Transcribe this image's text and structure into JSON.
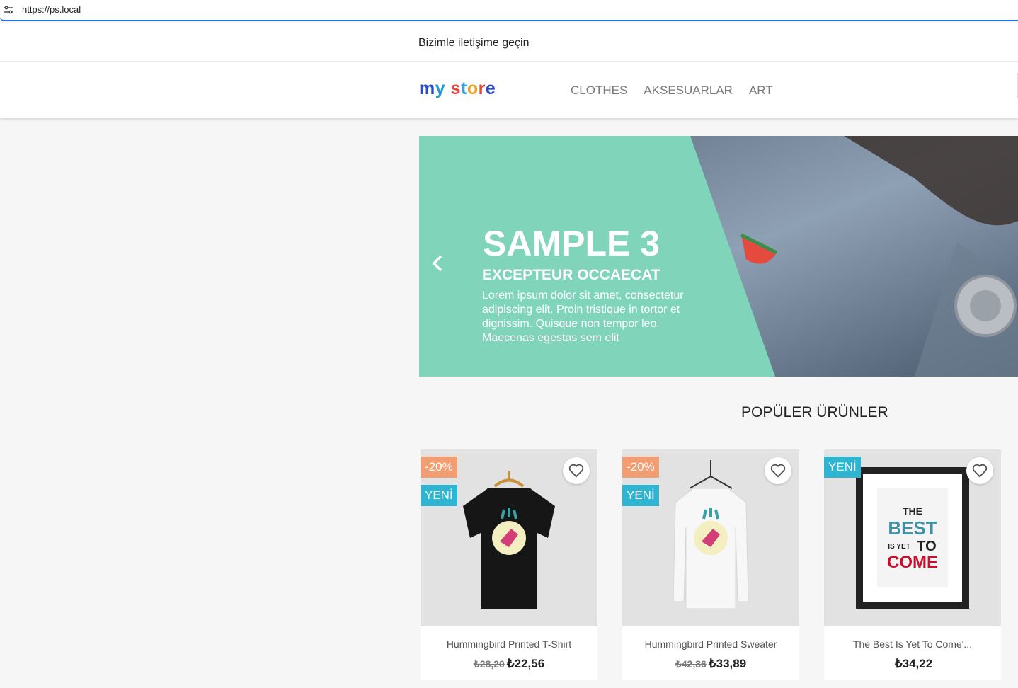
{
  "browser": {
    "url": "https://ps.local",
    "icon": "tune-icon"
  },
  "contact": {
    "text": "Bizimle iletişime geçin"
  },
  "logo": {
    "parts": [
      "m",
      "y",
      " ",
      "s",
      "t",
      "o",
      "r",
      "e"
    ]
  },
  "menu": {
    "items": [
      "CLOTHES",
      "AKSESUARLAR",
      "ART"
    ]
  },
  "slide": {
    "title": "SAMPLE 3",
    "subtitle": "EXCEPTEUR OCCAECAT",
    "text": "Lorem ipsum dolor sit amet, consectetur adipiscing elit. Proin tristique in tortor et dignissim. Quisque non tempor leo. Maecenas egestas sem elit",
    "accent_color": "#80d4b9"
  },
  "section": {
    "title": "POPÜLER ÜRÜNLER"
  },
  "products": [
    {
      "name": "Hummingbird Printed T-Shirt",
      "old_price": "₺28,20",
      "price": "₺22,56",
      "discount": "-20%",
      "new_label": "YENİ"
    },
    {
      "name": "Hummingbird Printed Sweater",
      "old_price": "₺42,36",
      "price": "₺33,89",
      "discount": "-20%",
      "new_label": "YENİ"
    },
    {
      "name": "The Best Is Yet To Come'...",
      "old_price": "",
      "price": "₺34,22",
      "discount": "",
      "new_label": "YENİ"
    }
  ],
  "poster": {
    "line1": "THE",
    "line2": "BEST",
    "line3": "IS YET",
    "line4": "TO",
    "line5": "COME"
  },
  "colors": {
    "discount": "#f39d72",
    "new": "#2fb5d2",
    "focus": "#1a73e8"
  }
}
